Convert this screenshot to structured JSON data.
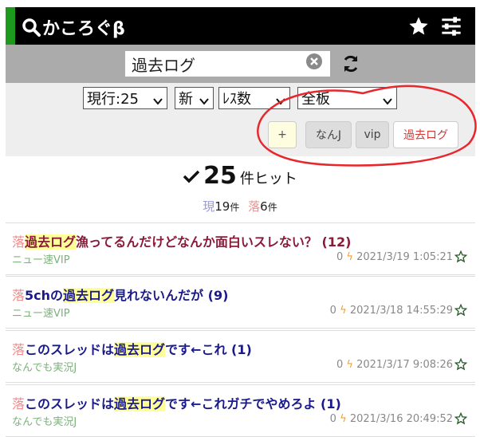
{
  "app": {
    "title": "かころぐβ"
  },
  "search": {
    "value": "過去ログ"
  },
  "filters": {
    "sort_select": "現行:25",
    "order_select": "新",
    "count_select": "ﾚｽ数",
    "board_select": "全板"
  },
  "tags": {
    "add": "+",
    "items": [
      "なんJ",
      "vip",
      "過去ログ"
    ]
  },
  "results": {
    "count": "25",
    "unit": "件ヒット",
    "current_label": "現",
    "current_count": "19",
    "fallen_label": "落",
    "fallen_count": "6",
    "unit_small": "件"
  },
  "threads": [
    {
      "fallen_mark": "落",
      "pre": "",
      "highlight": "過去ログ",
      "post": "漁ってるんだけどなんか面白いスレない？",
      "count": "(12)",
      "board": "ニュー速VIP",
      "res": "0",
      "date": "2021/3/19 1:05:21"
    },
    {
      "fallen_mark": "落",
      "pre": "5chの",
      "highlight": "過去ログ",
      "post": "見れないんだが",
      "count": "(9)",
      "board": "ニュー速VIP",
      "res": "0",
      "date": "2021/3/18 14:55:29"
    },
    {
      "fallen_mark": "落",
      "pre": "このスレッドは",
      "highlight": "過去ログ",
      "post": "です←これ",
      "count": "(1)",
      "board": "なんでも実況J",
      "res": "0",
      "date": "2021/3/17 9:08:26"
    },
    {
      "fallen_mark": "落",
      "pre": "このスレッドは",
      "highlight": "過去ログ",
      "post": "です←これガチでやめろよ",
      "count": "(1)",
      "board": "なんでも実況J",
      "res": "0",
      "date": "2021/3/16 20:49:52"
    }
  ],
  "colors": {
    "header_bg": "#000000",
    "accent_green": "#1d9a1d",
    "search_bar_bg": "#ababab",
    "title_link": "#1a1a8a",
    "fallen_red": "#f28b8b",
    "board_green": "#7cb27c",
    "bolt_orange": "#f0a030",
    "annotation_red": "#e8262b"
  },
  "icons": [
    "search-icon",
    "star-icon",
    "settings-sliders-icon",
    "clear-icon",
    "refresh-icon",
    "checkmark-icon",
    "bolt-icon",
    "favorite-star-icon"
  ]
}
